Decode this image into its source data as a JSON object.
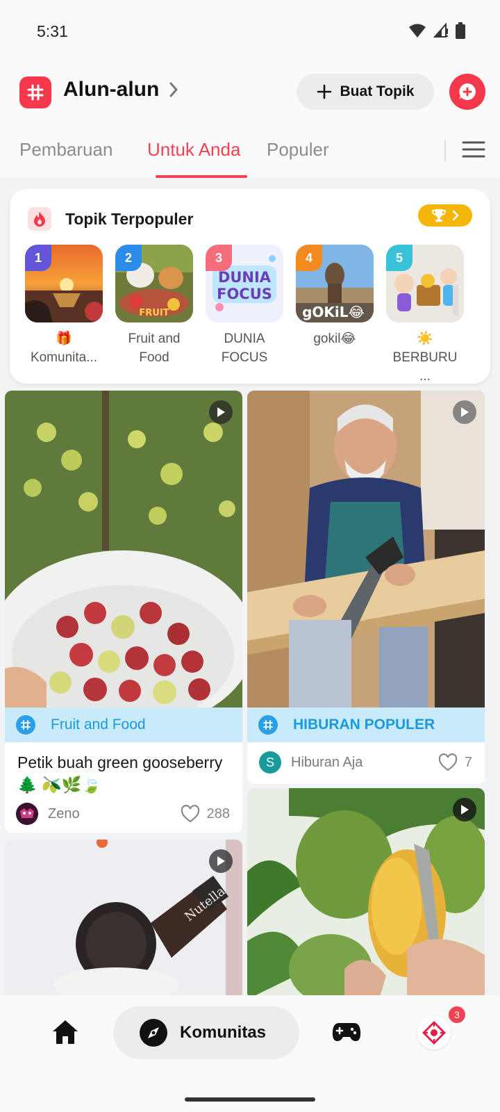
{
  "status_bar": {
    "time": "5:31"
  },
  "header": {
    "title": "Alun-alun",
    "create_label": "Buat Topik"
  },
  "tabs": [
    {
      "label": "Pembaruan"
    },
    {
      "label": "Untuk Anda"
    },
    {
      "label": "Populer"
    }
  ],
  "topics": {
    "title": "Topik Terpopuler",
    "items": [
      {
        "rank": "1",
        "name": "🎁 Komunita..."
      },
      {
        "rank": "2",
        "name": "Fruit and Food"
      },
      {
        "rank": "3",
        "name": "DUNIA FOCUS"
      },
      {
        "rank": "4",
        "name": "gokil😂"
      },
      {
        "rank": "5",
        "name": "☀️ BERBURU ..."
      }
    ]
  },
  "thumb_text": {
    "dunia": "DUNIA",
    "focus": "FOCUS",
    "gokil": "gOKiL😂",
    "fruit": "FRUIT"
  },
  "feed": {
    "post1": {
      "tag": "Fruit and Food",
      "title": "Petik buah green gooseberry 🌲 🫒🌿🍃",
      "author": "Zeno",
      "likes": "288"
    },
    "post2": {
      "tag": "HIBURAN POPULER",
      "author": "Hiburan Aja",
      "avatar_letter": "S",
      "likes": "7"
    },
    "post3": {
      "bottle_text": "Nutella"
    }
  },
  "bottom_nav": {
    "komunitas_label": "Komunitas",
    "badge": "3"
  },
  "colors": {
    "accent": "#f24152",
    "tag_bg": "#c9ebf9",
    "tag_text": "#1a98e0",
    "trophy": "#f5b60a"
  }
}
